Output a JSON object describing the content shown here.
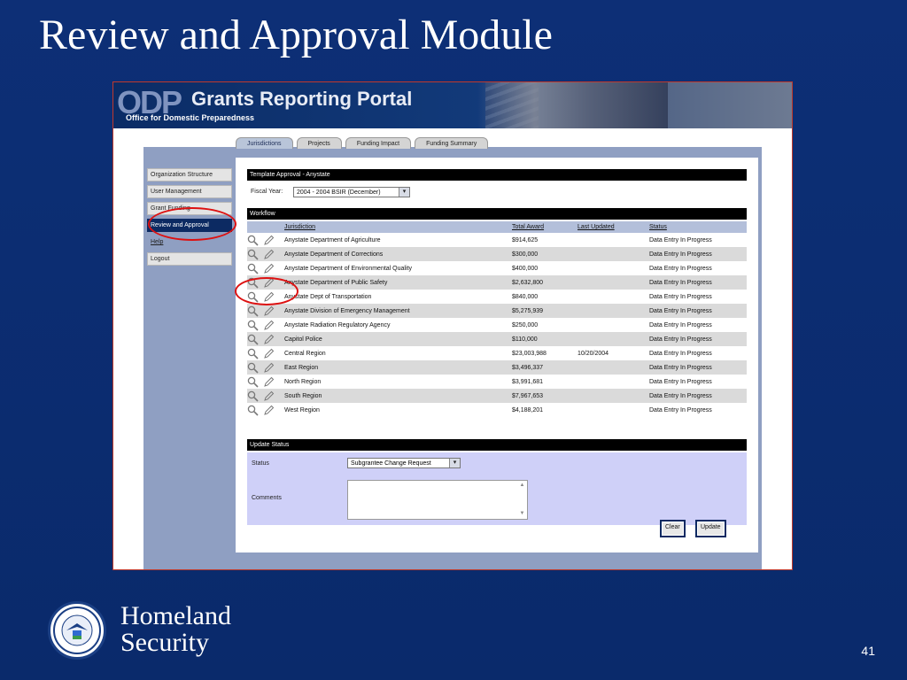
{
  "slide": {
    "title": "Review and Approval Module",
    "page_number": "41",
    "footer_brand_line1": "Homeland",
    "footer_brand_line2": "Security"
  },
  "portal": {
    "logo": "ODP",
    "name": "Grants Reporting Portal",
    "subtitle": "Office for Domestic Preparedness",
    "tabs": [
      {
        "label": "Jurisdictions",
        "active": true
      },
      {
        "label": "Projects"
      },
      {
        "label": "Funding Impact"
      },
      {
        "label": "Funding Summary"
      }
    ],
    "sidebar": [
      {
        "label": "Organization Structure"
      },
      {
        "label": "User Management"
      },
      {
        "label": "Grant Funding"
      },
      {
        "label": "Review and Approval",
        "active": true
      },
      {
        "label": "Help"
      },
      {
        "label": "Logout"
      }
    ]
  },
  "template": {
    "header": "Template Approval - Anystate",
    "fiscal_label": "Fiscal Year:",
    "fiscal_value": "2004 - 2004 BSIR (December)"
  },
  "workflow": {
    "header": "Workflow",
    "columns": [
      "Jurisdiction",
      "Total Award",
      "Last Updated",
      "Status"
    ],
    "rows": [
      {
        "jurisdiction": "Anystate Department of Agriculture",
        "award": "$914,625",
        "updated": "",
        "status": "Data Entry In Progress"
      },
      {
        "jurisdiction": "Anystate Department of Corrections",
        "award": "$300,000",
        "updated": "",
        "status": "Data Entry In Progress"
      },
      {
        "jurisdiction": "Anystate Department of Environmental Quality",
        "award": "$400,000",
        "updated": "",
        "status": "Data Entry In Progress"
      },
      {
        "jurisdiction": "Anystate Department of Public Safety",
        "award": "$2,632,800",
        "updated": "",
        "status": "Data Entry In Progress"
      },
      {
        "jurisdiction": "Anystate Dept of Transportation",
        "award": "$840,000",
        "updated": "",
        "status": "Data Entry In Progress"
      },
      {
        "jurisdiction": "Anystate Division of Emergency Management",
        "award": "$5,275,939",
        "updated": "",
        "status": "Data Entry In Progress"
      },
      {
        "jurisdiction": "Anystate Radiation Regulatory Agency",
        "award": "$250,000",
        "updated": "",
        "status": "Data Entry In Progress"
      },
      {
        "jurisdiction": "Capitol Police",
        "award": "$110,000",
        "updated": "",
        "status": "Data Entry In Progress"
      },
      {
        "jurisdiction": "Central Region",
        "award": "$23,003,988",
        "updated": "10/20/2004",
        "status": "Data Entry In Progress"
      },
      {
        "jurisdiction": "East Region",
        "award": "$3,496,337",
        "updated": "",
        "status": "Data Entry In Progress"
      },
      {
        "jurisdiction": "North Region",
        "award": "$3,991,681",
        "updated": "",
        "status": "Data Entry In Progress"
      },
      {
        "jurisdiction": "South Region",
        "award": "$7,967,653",
        "updated": "",
        "status": "Data Entry In Progress"
      },
      {
        "jurisdiction": "West Region",
        "award": "$4,188,201",
        "updated": "",
        "status": "Data Entry In Progress"
      }
    ]
  },
  "update_status": {
    "header": "Update Status",
    "status_label": "Status",
    "status_value": "Subgrantee Change Request",
    "comments_label": "Comments",
    "clear_label": "Clear",
    "update_label": "Update"
  },
  "colors": {
    "slide_bg": "#0a2a6c",
    "nav_active": "#0c2a62",
    "highlight_ring": "#dd1111"
  }
}
